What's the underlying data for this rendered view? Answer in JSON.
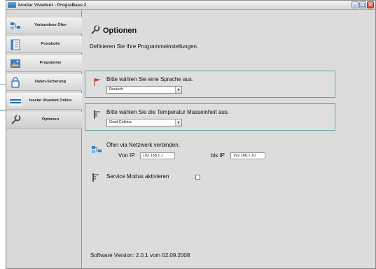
{
  "window": {
    "title": "Ivoclar Vivadent - PrograBase 2",
    "controls": {
      "minimize": "–",
      "maximize": "□",
      "close": "×"
    }
  },
  "sidebar": {
    "items": [
      {
        "label": "Verbundene Öfen",
        "icon": "connected-furnaces-icon"
      },
      {
        "label": "Protokolle",
        "icon": "protocols-icon"
      },
      {
        "label": "Programme",
        "icon": "programs-icon"
      },
      {
        "label": "Daten-Sicherung",
        "icon": "data-backup-icon"
      },
      {
        "label": "Ivoclar Vivadent Online",
        "icon": "ivoclar-logo-icon"
      },
      {
        "label": "Optionen",
        "icon": "options-icon",
        "active": true
      }
    ]
  },
  "main": {
    "title": "Optionen",
    "description": "Definieren Sie Ihre Programmeinstellungen.",
    "language": {
      "label": "Bitte wählen Sie eine Sprache aus.",
      "selected": "Deutsch"
    },
    "temperature": {
      "label": "Bitte wählen Sie die Temperatur Masseinheit aus.",
      "selected": "Grad Celsius"
    },
    "network": {
      "label": "Öfen via Netzwerk verbinden.",
      "from_label": "Von IP",
      "from_value": "192.168.1.1",
      "to_label": "bis IP",
      "to_value": "192.168.1.10"
    },
    "service": {
      "label": "Service Modus aktivieren",
      "checked": false
    },
    "footer": "Software Version: 2.0.1 vom 02.09.2008"
  },
  "colors": {
    "group_border": "#5aa5a0",
    "background": "#dcdcdc",
    "sidebar": "#d8d8d8"
  }
}
